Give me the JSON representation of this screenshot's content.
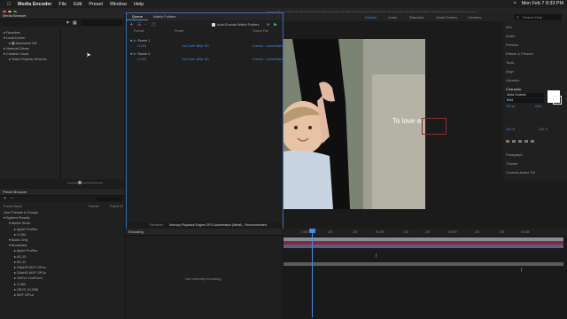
{
  "menubar": {
    "items": [
      "Media Encoder",
      "File",
      "Edit",
      "Preset",
      "Window",
      "Help"
    ],
    "clock": "Mon Feb 7  8:33 PM"
  },
  "window": {
    "title": "/Users/Shared/Applications/Adobe Premiere/Applications/Amazing Templates Agency/Example Animation/mediaplant-template.prproj *"
  },
  "premiere": {
    "workspaces": [
      "Default",
      "Learn",
      "Standard",
      "Small Screen",
      "Libraries"
    ],
    "search_placeholder": "Search Help"
  },
  "media_browser": {
    "title": "Media Browser",
    "tree": [
      "Favorites",
      "Local Drives",
      "Macintosh HD",
      "Network Drives",
      "Creative Cloud",
      "Team Projects Versions"
    ]
  },
  "queue": {
    "tabs": [
      "Queue",
      "Watch Folders"
    ],
    "auto_encode_label": "Auto-Encode Watch Folders",
    "columns": [
      "Format",
      "Preset",
      "Output File"
    ],
    "items": [
      {
        "name": "Scene 1",
        "format": "H.264",
        "preset": "YouTube 480p SD",
        "output": "/Users/.../sceneName"
      },
      {
        "name": "Scene 2",
        "format": "H.264",
        "preset": "YouTube 480p SD",
        "output": "/Users/.../sceneName"
      }
    ]
  },
  "preset_browser": {
    "title": "Preset Browser",
    "columns": [
      "Preset Name",
      "Format",
      "Frame Si"
    ],
    "sections": [
      "User Presets & Groups",
      "System Presets"
    ],
    "items": [
      "Adobe Stock",
      "Apple ProRes",
      "H.264",
      "Audio Only",
      "Broadcast",
      "Apple ProRes",
      "AS-10",
      "AS-11",
      "DNxHR MXF OP1a",
      "DNxHD MXF OP1a",
      "GoPro CineForm",
      "H.264",
      "HEVC (H.265)",
      "MXF OP1a"
    ]
  },
  "encoding": {
    "title": "Encoding",
    "renderer_label": "Renderer:",
    "renderer_value": "Mercury Playback Engine GPU Acceleration (Metal) - Recommended",
    "status": "Not currently encoding."
  },
  "preview": {
    "overlay_text": "To love a"
  },
  "properties": {
    "items": [
      "Info",
      "Audio",
      "Preview",
      "Effects & Presets",
      "Tools",
      "Align",
      "Libraries",
      "Character",
      "Paragraph",
      "Tracker",
      "Content-Aware Fill"
    ],
    "font_name": "Alida Grotesk",
    "font_style": "Bold",
    "size_value": "130 px",
    "leading_value": "Auto",
    "scale_value": "100 %"
  },
  "timeline": {
    "ticks": [
      "0:00f",
      "10f",
      "20f",
      "01:00f",
      "10f",
      "20f",
      "02:00f",
      "10f",
      "20f",
      "03:00f"
    ]
  }
}
